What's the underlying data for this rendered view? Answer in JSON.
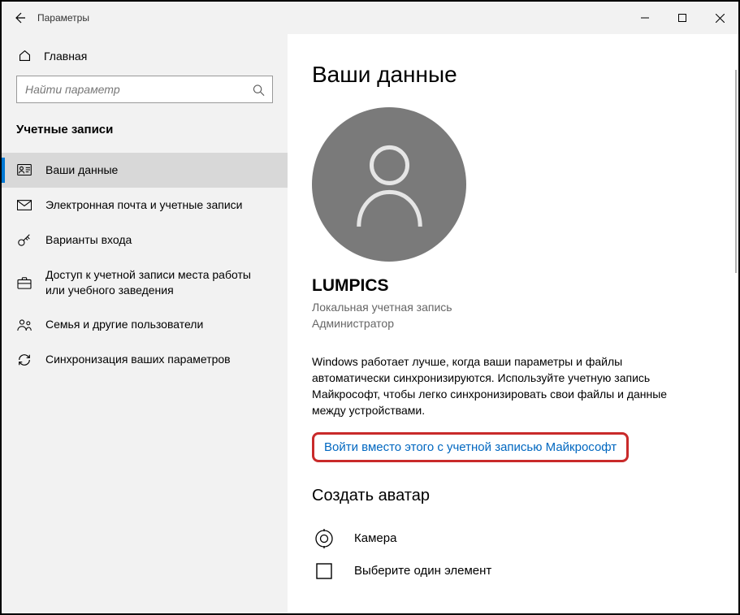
{
  "window": {
    "title": "Параметры"
  },
  "sidebar": {
    "home": "Главная",
    "search_placeholder": "Найти параметр",
    "category": "Учетные записи",
    "items": [
      {
        "label": "Ваши данные",
        "icon": "user-card-icon",
        "active": true
      },
      {
        "label": "Электронная почта и учетные записи",
        "icon": "mail-icon"
      },
      {
        "label": "Варианты входа",
        "icon": "key-icon"
      },
      {
        "label": "Доступ к учетной записи места работы или учебного заведения",
        "icon": "briefcase-icon"
      },
      {
        "label": "Семья и другие пользователи",
        "icon": "people-icon"
      },
      {
        "label": "Синхронизация ваших параметров",
        "icon": "sync-icon"
      }
    ]
  },
  "main": {
    "heading": "Ваши данные",
    "username": "LUMPICS",
    "account_type": "Локальная учетная запись",
    "account_role": "Администратор",
    "description": "Windows работает лучше, когда ваши параметры и файлы автоматически синхронизируются. Используйте учетную запись Майкрософт, чтобы легко синхронизировать свои файлы и данные между устройствами.",
    "ms_link": "Войти вместо этого с учетной записью Майкрософт",
    "create_avatar_heading": "Создать аватар",
    "options": [
      {
        "label": "Камера",
        "icon": "camera-icon"
      },
      {
        "label": "Выберите один элемент",
        "icon": "browse-icon"
      }
    ]
  }
}
